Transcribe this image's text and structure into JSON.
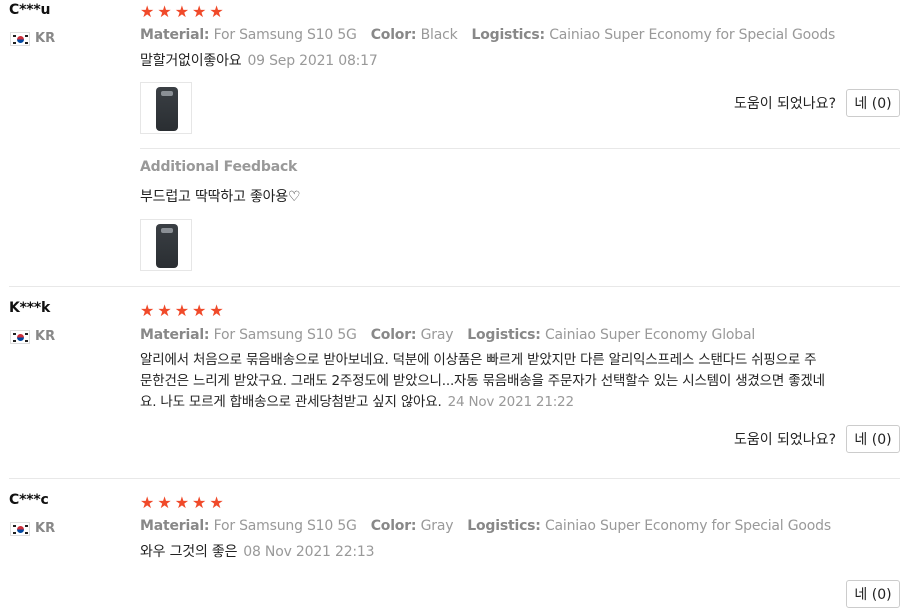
{
  "reviews": [
    {
      "user": "C***u",
      "country": "KR",
      "stars": 5,
      "material_label": "Material:",
      "material": "For Samsung S10 5G",
      "color_label": "Color:",
      "color": "Black",
      "logistics_label": "Logistics:",
      "logistics": "Cainiao Super Economy for Special Goods",
      "text": "말할거없이좋아요",
      "date": "09 Sep 2021 08:17",
      "additional_label": "Additional Feedback",
      "additional_text": "부드럽고 딱딱하고 좋아용♡",
      "helpful_label": "도움이 되었나요?",
      "helpful_button": "네 (0)"
    },
    {
      "user": "K***k",
      "country": "KR",
      "stars": 5,
      "material_label": "Material:",
      "material": "For Samsung S10 5G",
      "color_label": "Color:",
      "color": "Gray",
      "logistics_label": "Logistics:",
      "logistics": "Cainiao Super Economy Global",
      "text_line1": "알리에서 처음으로 묶음배송으로 받아보네요. 덕분에 이상품은 빠르게 받았지만 다른 알리익스프레스 스탠다드 쉬핑으로 주",
      "text_line2": "문한건은 느리게 받았구요. 그래도 2주정도에 받았으니...자동 묶음배송을 주문자가 선택할수 있는 시스템이 생겼으면 좋겠네",
      "text_line3": "요. 나도 모르게 합배송으로 관세당첨받고 싶지 않아요.",
      "date": "24 Nov 2021 21:22",
      "helpful_label": "도움이 되었나요?",
      "helpful_button": "네 (0)"
    },
    {
      "user": "C***c",
      "country": "KR",
      "stars": 5,
      "material_label": "Material:",
      "material": "For Samsung S10 5G",
      "color_label": "Color:",
      "color": "Gray",
      "logistics_label": "Logistics:",
      "logistics": "Cainiao Super Economy for Special Goods",
      "text": "와우 그것의 좋은",
      "date": "08 Nov 2021 22:13",
      "helpful_button": "네 (0)"
    }
  ],
  "colors": {
    "star": "#f04a2a",
    "meta_gray": "#999999"
  },
  "icons": {
    "star": "star-icon",
    "flag": "korea-flag-icon",
    "thumb": "phone-case-thumbnail"
  }
}
